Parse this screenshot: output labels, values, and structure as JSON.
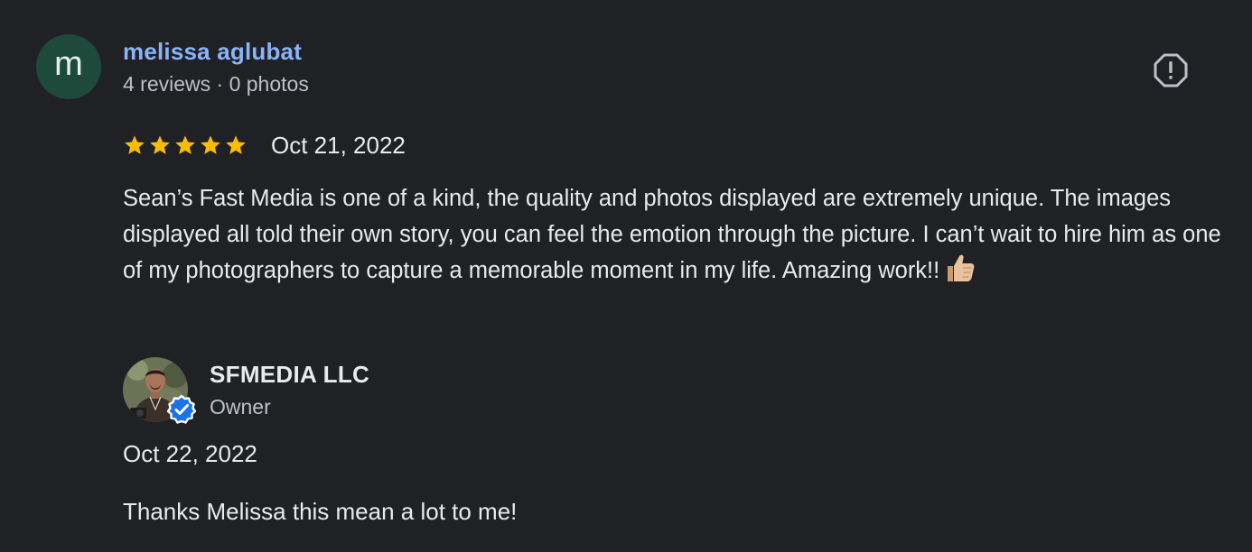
{
  "reviewer": {
    "avatar_letter": "m",
    "avatar_color": "#1e4a3c",
    "name": "melissa aglubat",
    "meta": "4 reviews · 0 photos"
  },
  "report": {
    "icon": "report-flag-icon"
  },
  "rating": {
    "stars": 5,
    "max_stars": 5,
    "star_color": "#fbbc04"
  },
  "review": {
    "date": "Oct 21, 2022",
    "text": "Sean’s Fast Media is one of a kind, the quality and photos displayed are extremely unique. The images displayed all told their own story, you can feel the emotion through the picture. I can’t wait to hire him as one of my photographers to capture a memorable moment in my life. Amazing work!!",
    "emoji": "thumbs-up-icon"
  },
  "owner_reply": {
    "name": "SFMEDIA LLC",
    "role": "Owner",
    "verified_icon": "verified-badge-icon",
    "date": "Oct 22, 2022",
    "text": "Thanks Melissa this mean a lot to me!"
  },
  "colors": {
    "background": "#202124",
    "name_link": "#8ab4f8",
    "primary_text": "#e8eaed",
    "secondary_text": "#bdc1c6",
    "verified_blue": "#1a73e8"
  }
}
